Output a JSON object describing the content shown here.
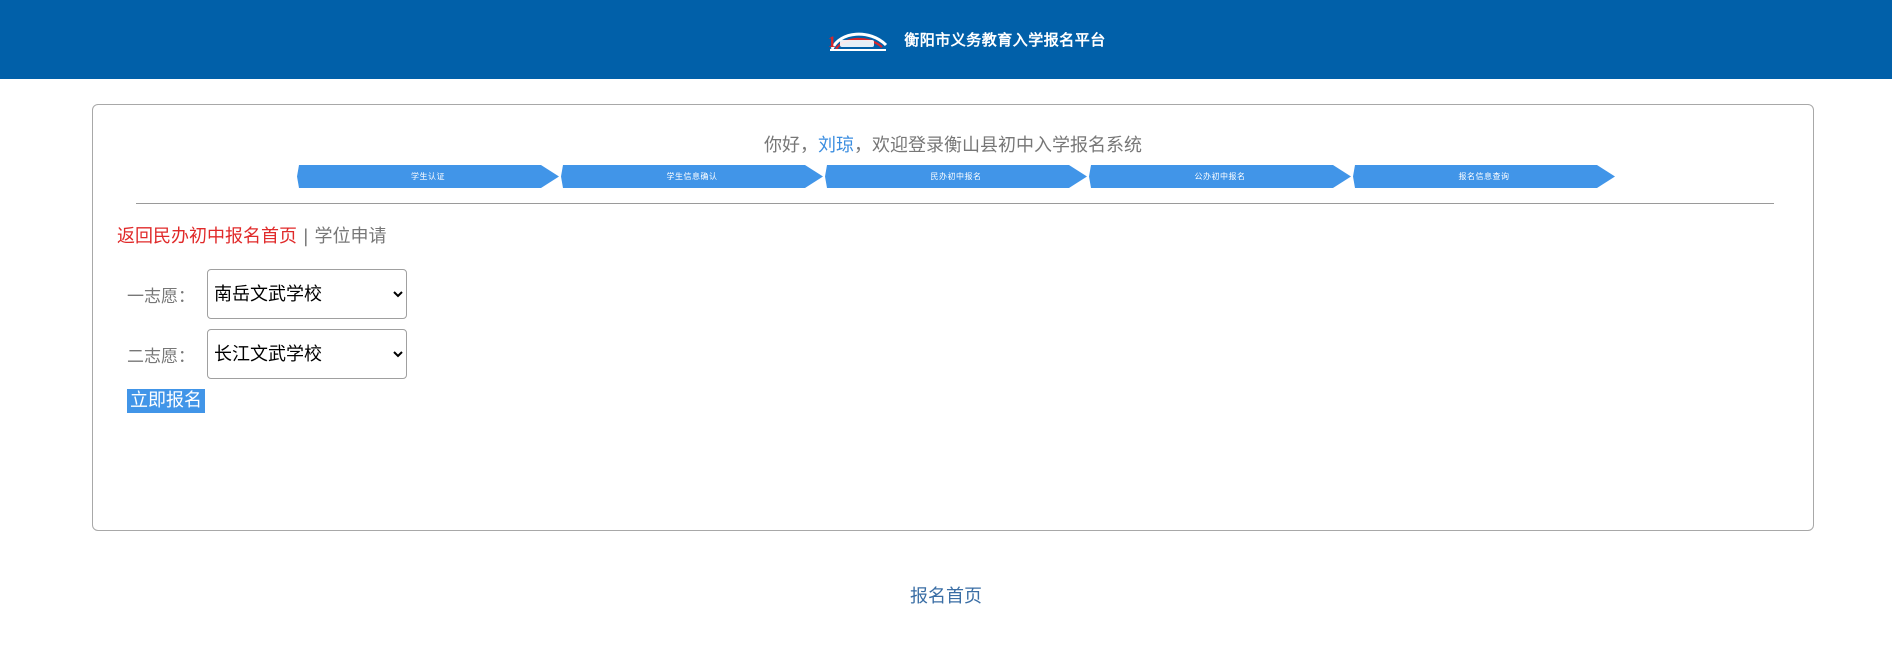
{
  "header": {
    "site_title": "衡阳市义务教育入学报名平台",
    "logo_icon": "platform-logo-icon",
    "bg_color": "#0160a9"
  },
  "welcome": {
    "prefix": "你好，",
    "user_name": "刘琼",
    "suffix": "，欢迎登录衡山县初中入学报名系统"
  },
  "steps": [
    {
      "label": "学生认证"
    },
    {
      "label": "学生信息确认"
    },
    {
      "label": "民办初中报名"
    },
    {
      "label": "公办初中报名"
    },
    {
      "label": "报名信息查询"
    }
  ],
  "links": {
    "back_label": "返回民办初中报名首页",
    "separator": " | ",
    "apply_label": "学位申请"
  },
  "form": {
    "choice1_label": "一志愿：",
    "choice1_value": "南岳文武学校",
    "choice2_label": "二志愿：",
    "choice2_value": "长江文武学校",
    "submit_label": "立即报名"
  },
  "footer": {
    "home_link": "报名首页"
  },
  "colors": {
    "step_blue": "#4195e8",
    "link_red": "#e02a2a",
    "user_blue": "#3b8ee0"
  }
}
